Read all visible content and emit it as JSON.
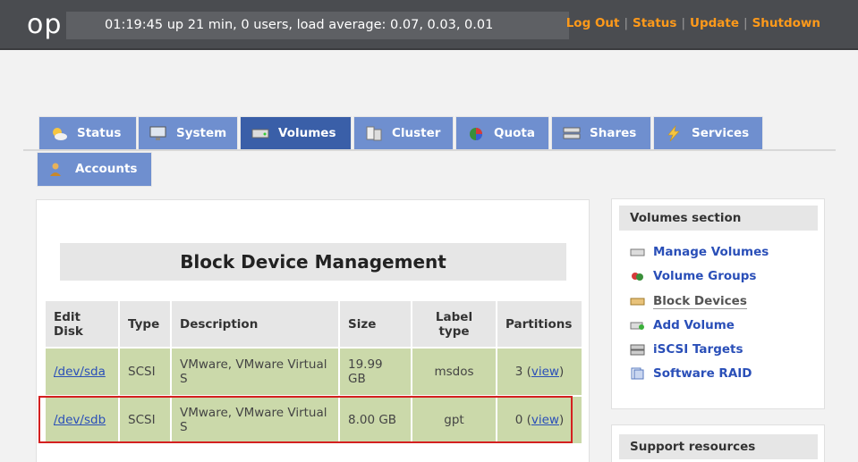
{
  "header": {
    "logo_text": "op",
    "uptime_text": "01:19:45 up 21 min, 0 users, load average: 0.07, 0.03, 0.01",
    "links": [
      {
        "label": "Log Out"
      },
      {
        "label": "Status"
      },
      {
        "label": "Update"
      },
      {
        "label": "Shutdown"
      }
    ],
    "link_color": "#ff9a1a"
  },
  "tabs": [
    {
      "label": "Status",
      "icon": "sun-cloud-icon"
    },
    {
      "label": "System",
      "icon": "monitor-icon"
    },
    {
      "label": "Volumes",
      "icon": "drive-icon",
      "active": true
    },
    {
      "label": "Cluster",
      "icon": "cluster-icon"
    },
    {
      "label": "Quota",
      "icon": "pie-chart-icon"
    },
    {
      "label": "Shares",
      "icon": "server-icon"
    },
    {
      "label": "Services",
      "icon": "lightning-icon"
    },
    {
      "label": "Accounts",
      "icon": "users-icon"
    }
  ],
  "main": {
    "title": "Block Device Management",
    "table": {
      "headers": {
        "edit_disk": "Edit Disk",
        "type": "Type",
        "description": "Description",
        "size": "Size",
        "label_type": "Label type",
        "partitions": "Partitions"
      },
      "rows": [
        {
          "disk": "/dev/sda",
          "type": "SCSI",
          "description": "VMware, VMware Virtual S",
          "size": "19.99 GB",
          "label_type": "msdos",
          "partitions": "3",
          "view": "view"
        },
        {
          "disk": "/dev/sdb",
          "type": "SCSI",
          "description": "VMware, VMware Virtual S",
          "size": "8.00 GB",
          "label_type": "gpt",
          "partitions": "0",
          "view": "view"
        }
      ]
    }
  },
  "sidebar": {
    "title": "Volumes section",
    "items": [
      {
        "label": "Manage Volumes",
        "icon": "drive-icon"
      },
      {
        "label": "Volume Groups",
        "icon": "volume-groups-icon"
      },
      {
        "label": "Block Devices",
        "icon": "block-devices-icon",
        "current": true
      },
      {
        "label": "Add Volume",
        "icon": "add-volume-icon"
      },
      {
        "label": "iSCSI Targets",
        "icon": "iscsi-icon"
      },
      {
        "label": "Software RAID",
        "icon": "raid-icon"
      }
    ],
    "support_title": "Support resources"
  },
  "colors": {
    "tab_bg": "#6f8fcf",
    "tab_active_bg": "#3a5fa8",
    "row_bg": "#cbd9aa",
    "highlight_border": "#d42020"
  }
}
